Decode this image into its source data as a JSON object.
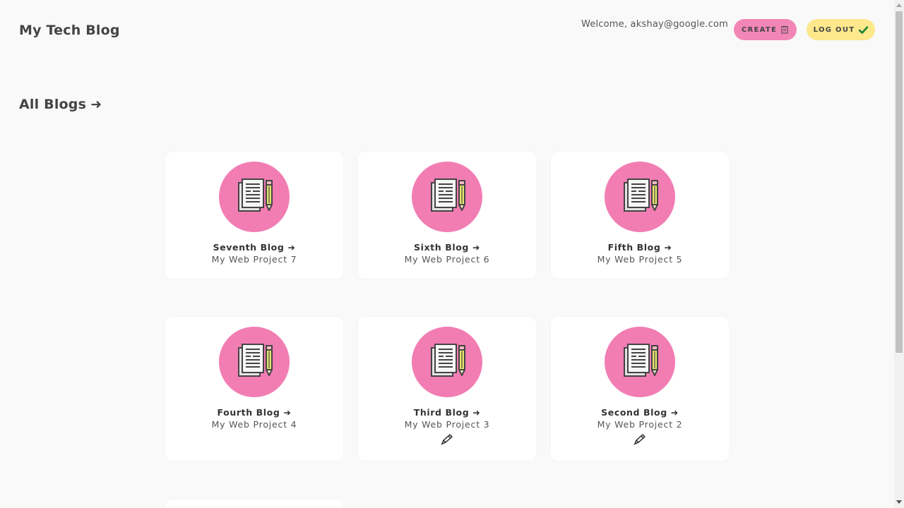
{
  "header": {
    "brand": "My Tech Blog",
    "welcome": "Welcome, akshay@google.com",
    "create_label": "CREATE",
    "logout_label": "LOG OUT"
  },
  "section": {
    "title": "All Blogs",
    "arrow": "➜"
  },
  "blogs": [
    {
      "title": "Seventh Blog ➜",
      "subtitle": "My Web Project 7"
    },
    {
      "title": "Sixth Blog ➜",
      "subtitle": "My Web Project 6"
    },
    {
      "title": "Fifth Blog ➜",
      "subtitle": "My Web Project 5"
    },
    {
      "title": "Fourth Blog ➜",
      "subtitle": "My Web Project 4"
    },
    {
      "title": "Third Blog ➜",
      "subtitle": "My Web Project 3"
    },
    {
      "title": "Second Blog ➜",
      "subtitle": "My Web Project 2"
    }
  ],
  "colors": {
    "accent_pink": "#f286b7",
    "accent_yellow": "#fde88c",
    "background": "#f9f9f9"
  },
  "icons": {
    "thumbnail": "document-pencil-icon",
    "edit": "pen-icon",
    "create": "notepad-icon",
    "logout": "check-icon"
  }
}
